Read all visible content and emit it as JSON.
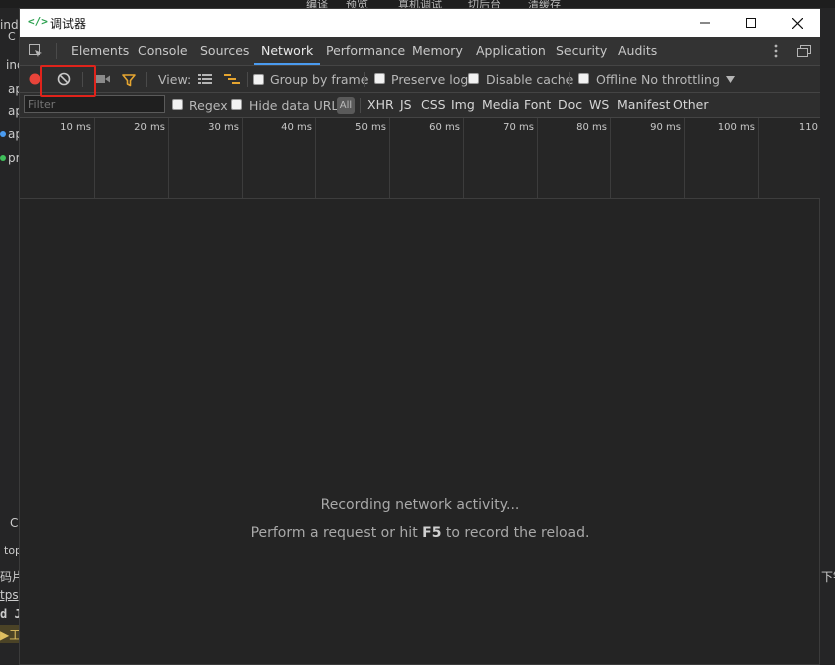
{
  "background_app": {
    "top_menu": [
      "编译",
      "预览",
      "真机调试",
      "切后台",
      "清缓存"
    ],
    "left_fragments": [
      "ind",
      "ap",
      "ap",
      "ap",
      "pr",
      "C",
      "top",
      "码片",
      "tps",
      "d J",
      "工"
    ],
    "right_fragments": [
      "下银"
    ]
  },
  "window": {
    "title": "调试器",
    "title_icon": "</>"
  },
  "tabs": [
    {
      "label": "Elements"
    },
    {
      "label": "Console"
    },
    {
      "label": "Sources"
    },
    {
      "label": "Network",
      "active": true
    },
    {
      "label": "Performance"
    },
    {
      "label": "Memory"
    },
    {
      "label": "Application"
    },
    {
      "label": "Security"
    },
    {
      "label": "Audits"
    }
  ],
  "toolbar": {
    "view_label": "View:",
    "group_by_frame": "Group by frame",
    "preserve_log": "Preserve log",
    "disable_cache": "Disable cache",
    "offline": "Offline",
    "throttling": "No throttling"
  },
  "filterbar": {
    "placeholder": "Filter",
    "regex": "Regex",
    "hide_data_urls": "Hide data URLs",
    "all": "All",
    "types": [
      "XHR",
      "JS",
      "CSS",
      "Img",
      "Media",
      "Font",
      "Doc",
      "WS",
      "Manifest",
      "Other"
    ]
  },
  "timeline": {
    "ticks": [
      "10 ms",
      "20 ms",
      "30 ms",
      "40 ms",
      "50 ms",
      "60 ms",
      "70 ms",
      "80 ms",
      "90 ms",
      "100 ms",
      "110"
    ]
  },
  "empty_state": {
    "line1": "Recording network activity...",
    "line2_prefix": "Perform a request or hit ",
    "line2_key": "F5",
    "line2_suffix": " to record the reload."
  },
  "colors": {
    "record_red": "#e8443a",
    "filter_orange": "#e5a530",
    "active_tab_underline": "#4a9bf0",
    "highlight_box": "#e0231b"
  }
}
